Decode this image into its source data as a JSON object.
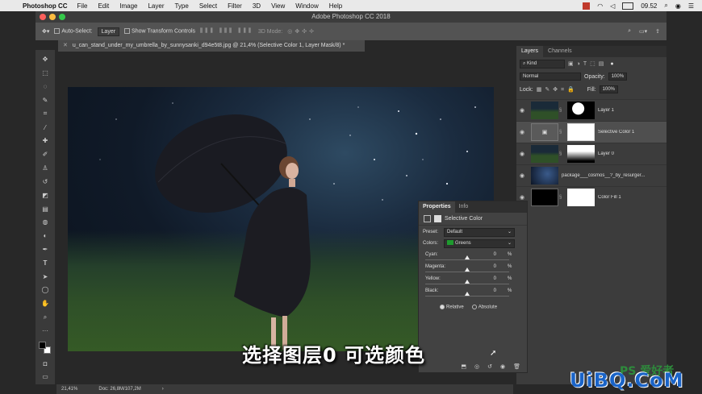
{
  "menubar": {
    "app_name": "Photoshop CC",
    "menus": [
      "File",
      "Edit",
      "Image",
      "Layer",
      "Type",
      "Select",
      "Filter",
      "3D",
      "View",
      "Window",
      "Help"
    ],
    "clock": "09.52"
  },
  "window": {
    "title": "Adobe Photoshop CC 2018"
  },
  "options_bar": {
    "auto_select_label": "Auto-Select:",
    "auto_select_value": "Layer",
    "transform_label": "Show Transform Controls",
    "mode_3d_label": "3D Mode:"
  },
  "document": {
    "tab_title": "u_can_stand_under_my_umbrella_by_sunnysanki_d94e5t8.jpg @ 21,4% (Selective Color 1, Layer Mask/8) *",
    "zoom": "21,41%",
    "doc_info": "Doc: 26,8M/107,2M"
  },
  "layers_panel": {
    "tabs": [
      "Layers",
      "Channels"
    ],
    "kind_label": "Kind",
    "blend_mode": "Normal",
    "opacity_label": "Opacity:",
    "opacity_value": "100%",
    "lock_label": "Lock:",
    "fill_label": "Fill:",
    "fill_value": "100%",
    "layers": [
      {
        "name": "Layer 1"
      },
      {
        "name": "Selective Color 1"
      },
      {
        "name": "Layer 0"
      },
      {
        "name": "package___cosmos__?_by_resurger..."
      },
      {
        "name": "Color Fill 1"
      }
    ]
  },
  "properties_panel": {
    "tabs": [
      "Properties",
      "Info"
    ],
    "adjustment_name": "Selective Color",
    "preset_label": "Preset:",
    "preset_value": "Default",
    "colors_label": "Colors:",
    "colors_value": "Greens",
    "colors_swatch": "#1e9a2e",
    "sliders": [
      {
        "label": "Cyan:",
        "value": "0",
        "unit": "%",
        "level": 0.5
      },
      {
        "label": "Magenta:",
        "value": "0",
        "unit": "%",
        "level": 0.5
      },
      {
        "label": "Yellow:",
        "value": "0",
        "unit": "%",
        "level": 0.5
      },
      {
        "label": "Black:",
        "value": "0",
        "unit": "%",
        "level": 0.5
      }
    ],
    "method_relative": "Relative",
    "method_absolute": "Absolute"
  },
  "overlay": {
    "subtitle": "选择图层0 可选颜色",
    "watermark_ps": "PS 爱好者",
    "watermark_brand": "UiBQ.CoM"
  }
}
